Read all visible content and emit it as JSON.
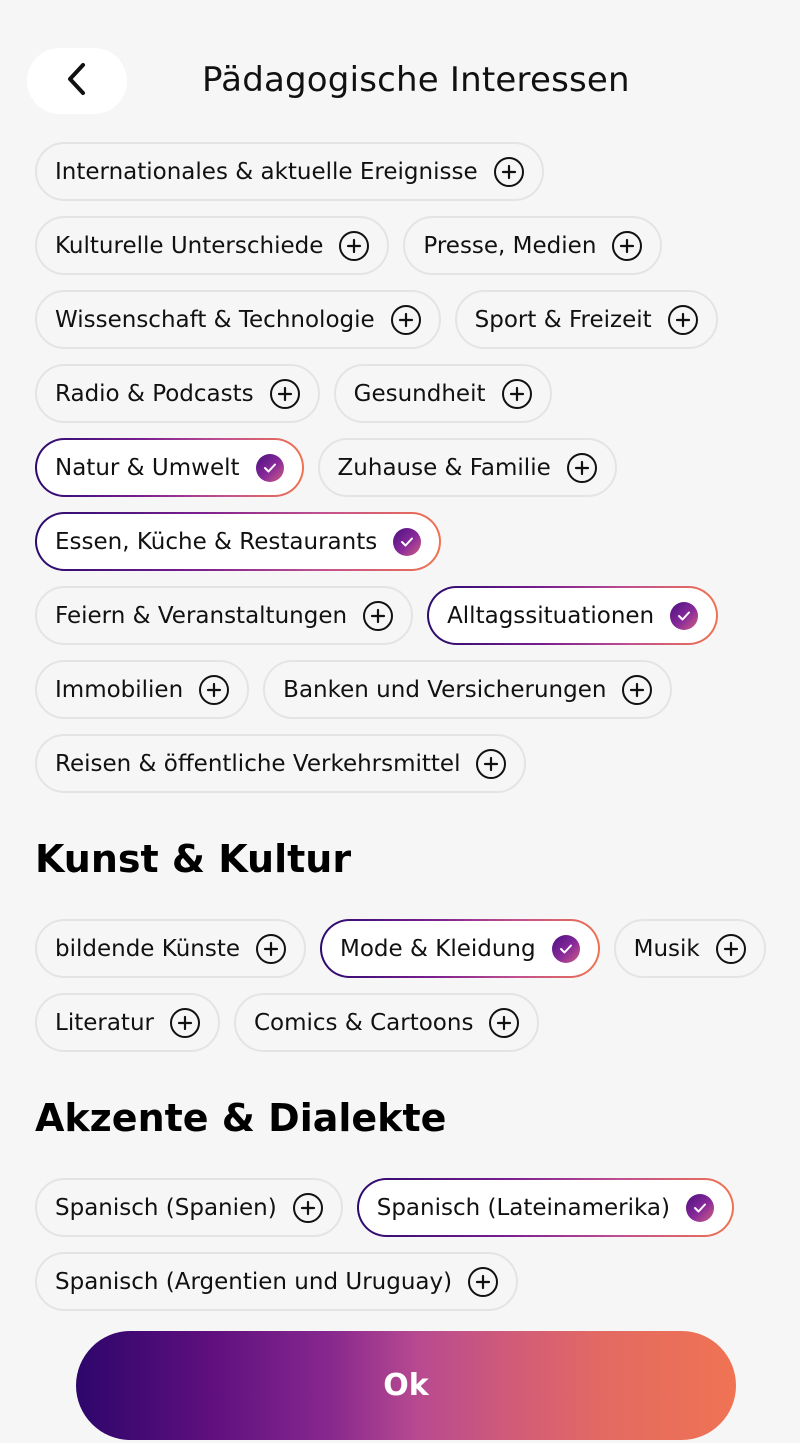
{
  "header": {
    "title": "Pädagogische Interessen",
    "back_icon": "chevron-left-icon"
  },
  "groups": [
    {
      "title": null,
      "chips": [
        {
          "label": "Internationales & aktuelle Ereignisse",
          "selected": false
        },
        {
          "label": "Kulturelle Unterschiede",
          "selected": false
        },
        {
          "label": "Presse, Medien",
          "selected": false
        },
        {
          "label": "Wissenschaft & Technologie",
          "selected": false
        },
        {
          "label": "Sport & Freizeit",
          "selected": false
        },
        {
          "label": "Radio & Podcasts",
          "selected": false
        },
        {
          "label": "Gesundheit",
          "selected": false
        },
        {
          "label": "Natur & Umwelt",
          "selected": true
        },
        {
          "label": "Zuhause & Familie",
          "selected": false
        },
        {
          "label": "Essen, Küche & Restaurants",
          "selected": true
        },
        {
          "label": "Feiern & Veranstaltungen",
          "selected": false
        },
        {
          "label": "Alltagssituationen",
          "selected": true
        },
        {
          "label": "Immobilien",
          "selected": false
        },
        {
          "label": "Banken und Versicherungen",
          "selected": false
        },
        {
          "label": "Reisen & öffentliche Verkehrsmittel",
          "selected": false
        }
      ]
    },
    {
      "title": "Kunst & Kultur",
      "chips": [
        {
          "label": "bildende Künste",
          "selected": false
        },
        {
          "label": "Mode & Kleidung",
          "selected": true
        },
        {
          "label": "Musik",
          "selected": false
        },
        {
          "label": "Literatur",
          "selected": false
        },
        {
          "label": "Comics & Cartoons",
          "selected": false
        }
      ]
    },
    {
      "title": "Akzente & Dialekte",
      "chips": [
        {
          "label": "Spanisch (Spanien)",
          "selected": false
        },
        {
          "label": "Spanisch (Lateinamerika)",
          "selected": true
        },
        {
          "label": "Spanisch (Argentien und Uruguay)",
          "selected": false
        }
      ]
    }
  ],
  "icons": {
    "unselected": "plus-circle-icon",
    "selected": "check-circle-icon"
  },
  "colors": {
    "gradient_start": "#2d066b",
    "gradient_mid": "#b84a90",
    "gradient_end": "#f07353",
    "background": "#f6f6f6"
  },
  "footer": {
    "ok_label": "Ok"
  }
}
